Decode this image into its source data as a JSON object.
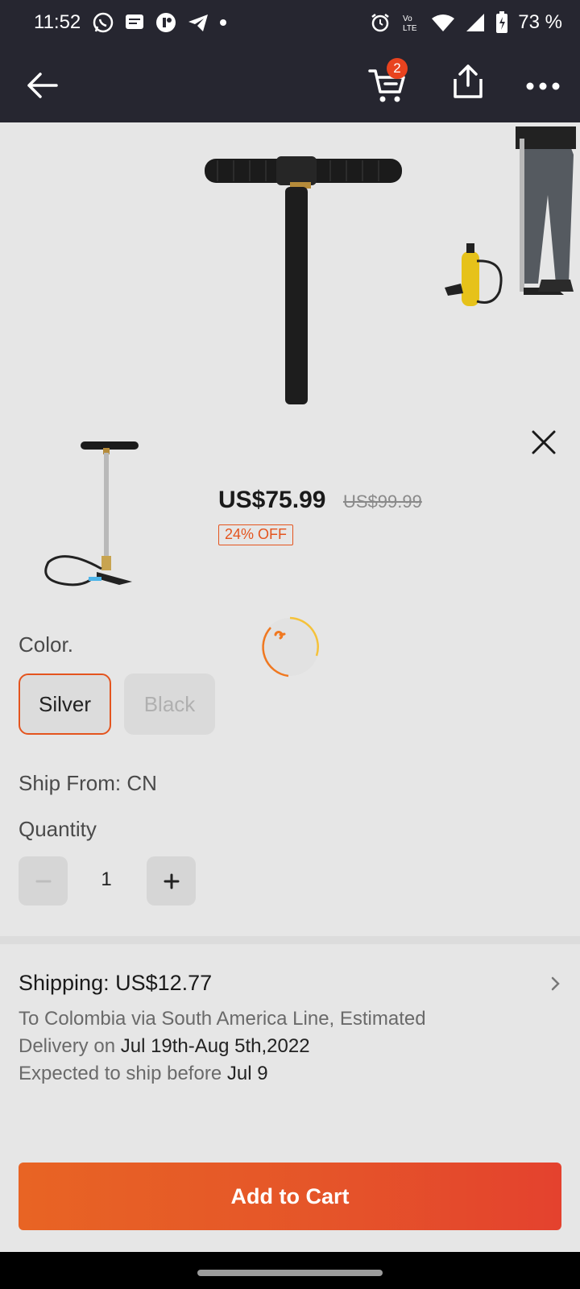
{
  "status_bar": {
    "time": "11:52",
    "battery": "73 %",
    "icons_left": [
      "whatsapp-icon",
      "message-icon",
      "app-icon",
      "telegram-icon",
      "dot-icon"
    ],
    "icons_right": [
      "alarm-icon",
      "volte-icon",
      "wifi-icon",
      "signal-icon",
      "battery-icon"
    ]
  },
  "app_bar": {
    "cart_count": "2"
  },
  "product": {
    "price": "US$75.99",
    "original_price": "US$99.99",
    "discount": "24% OFF"
  },
  "options": {
    "color_label": "Color.",
    "colors": [
      "Silver",
      "Black"
    ],
    "selected": "Silver",
    "ship_from": "Ship From: CN",
    "quantity_label": "Quantity",
    "quantity": "1"
  },
  "shipping": {
    "title": "Shipping: US$12.77",
    "line1": "To Colombia via South America Line, Estimated",
    "line2_prefix": "Delivery on ",
    "line2_date": "Jul 19th-Aug 5th,2022",
    "line3_prefix": "Expected to ship before ",
    "line3_date": "Jul 9"
  },
  "cta": {
    "add_to_cart": "Add to Cart"
  },
  "colors": {
    "accent": "#e4541e",
    "bar_bg": "#262630",
    "badge": "#e8431f"
  }
}
